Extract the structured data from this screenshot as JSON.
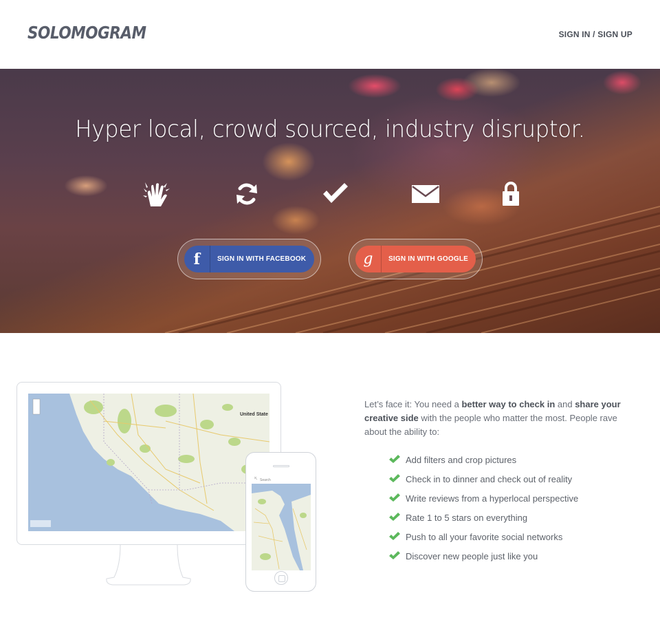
{
  "header": {
    "logo": "SOLOMOGRAM",
    "auth_link": "SIGN IN / SIGN UP"
  },
  "hero": {
    "title": "Hyper local, crowd sourced, industry disruptor.",
    "icons": [
      "high-five-icon",
      "refresh-icon",
      "checkmark-icon",
      "envelope-icon",
      "lock-icon"
    ],
    "facebook_button": {
      "icon": "f",
      "label": "SIGN IN WITH FACEBOOK",
      "color": "#3e5ba9"
    },
    "google_button": {
      "icon": "g",
      "label": "SIGN IN WITH GOOGLE",
      "color": "#e45f4a"
    }
  },
  "intro": {
    "part1": "Let’s face it: You need a ",
    "bold1": "better way to check in",
    "part2": " and ",
    "bold2": "share your creative side",
    "part3": " with the people who matter the most. People rave about the ability to:"
  },
  "map": {
    "label": "United State",
    "search_placeholder": "Search"
  },
  "features": [
    "Add filters and crop pictures",
    "Check in to dinner and check out of reality",
    "Write reviews from a hyperlocal perspective",
    "Rate 1 to 5 stars on everything",
    "Push to all your favorite social networks",
    "Discover new people just like you"
  ],
  "colors": {
    "check_green": "#5cb85c",
    "text": "#5d626a"
  }
}
